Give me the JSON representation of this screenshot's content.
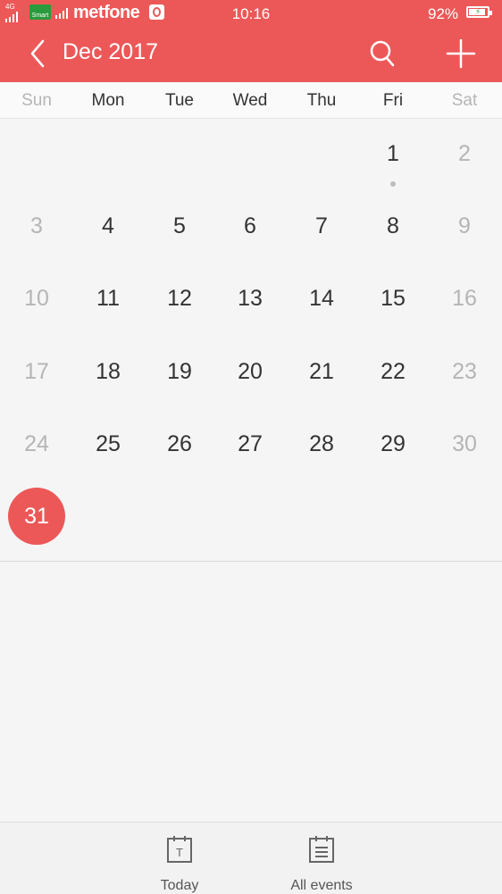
{
  "status_bar": {
    "network": "4G",
    "sim_badge": "Smart",
    "carrier": "metfone",
    "time": "10:16",
    "battery": "92%",
    "battery_level": 0.92
  },
  "header": {
    "title": "Dec 2017",
    "back_icon": "chevron-left-icon",
    "search_icon": "search-icon",
    "add_icon": "plus-icon",
    "background": "#ec5858"
  },
  "calendar": {
    "weekdays": [
      "Sun",
      "Mon",
      "Tue",
      "Wed",
      "Thu",
      "Fri",
      "Sat"
    ],
    "weeks": [
      [
        "",
        "",
        "",
        "",
        "",
        "1",
        "2"
      ],
      [
        "3",
        "4",
        "5",
        "6",
        "7",
        "8",
        "9"
      ],
      [
        "10",
        "11",
        "12",
        "13",
        "14",
        "15",
        "16"
      ],
      [
        "17",
        "18",
        "19",
        "20",
        "21",
        "22",
        "23"
      ],
      [
        "24",
        "25",
        "26",
        "27",
        "28",
        "29",
        "30"
      ],
      [
        "31",
        "",
        "",
        "",
        "",
        "",
        ""
      ]
    ],
    "today": "31",
    "event_days": [
      "1"
    ],
    "today_color": "#ec5858"
  },
  "bottom_nav": {
    "today_label": "Today",
    "today_icon_letter": "T",
    "all_events_label": "All events"
  }
}
